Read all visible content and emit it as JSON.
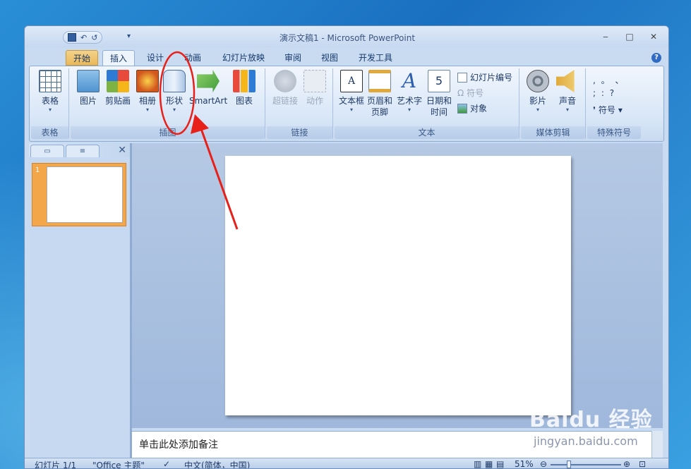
{
  "window": {
    "title": "演示文稿1 - Microsoft PowerPoint",
    "controls": {
      "minimize": "‒",
      "maximize": "□",
      "close": "✕"
    }
  },
  "qat": {
    "undo": "↶",
    "redo": "↺",
    "more": "▾"
  },
  "tabs": [
    {
      "label": "开始"
    },
    {
      "label": "插入"
    },
    {
      "label": "设计"
    },
    {
      "label": "动画"
    },
    {
      "label": "幻灯片放映"
    },
    {
      "label": "审阅"
    },
    {
      "label": "视图"
    },
    {
      "label": "开发工具"
    }
  ],
  "help": "?",
  "ribbon": {
    "groups": {
      "tables": {
        "label": "表格",
        "table": "表格"
      },
      "illustrations": {
        "label": "插图",
        "picture": "图片",
        "clipart": "剪贴画",
        "album": "相册",
        "shapes": "形状",
        "smartart": "SmartArt",
        "chart": "图表"
      },
      "links": {
        "label": "链接",
        "hyperlink": "超链接",
        "action": "动作"
      },
      "text": {
        "label": "文本",
        "textbox": "文本框",
        "header1": "页眉和",
        "header2": "页脚",
        "wordart": "艺术字",
        "datetime1": "日期和",
        "datetime2": "时间",
        "slide_number": "幻灯片编号",
        "symbol": "符号",
        "object": "对象"
      },
      "media": {
        "label": "媒体剪辑",
        "movie": "影片",
        "sound": "声音"
      },
      "special": {
        "label": "特殊符号",
        "symbol": "符号",
        "row1": ",   。  、",
        "row2": ";   :   ?",
        "bullet": "❜"
      }
    },
    "dropdown_arrow": "▾"
  },
  "left_pane": {
    "close": "✕",
    "slide_num": "1"
  },
  "notes": {
    "placeholder": "单击此处添加备注"
  },
  "status": {
    "slide": "幻灯片 1/1",
    "theme": "\"Office 主题\"",
    "language": "中文(简体，中国)",
    "zoom": "51%"
  },
  "watermark": {
    "brand": "Baidu 经验",
    "url": "jingyan.baidu.com"
  },
  "colors": {
    "annotation": "#e8201a",
    "active_tab": "#eef4fc"
  }
}
